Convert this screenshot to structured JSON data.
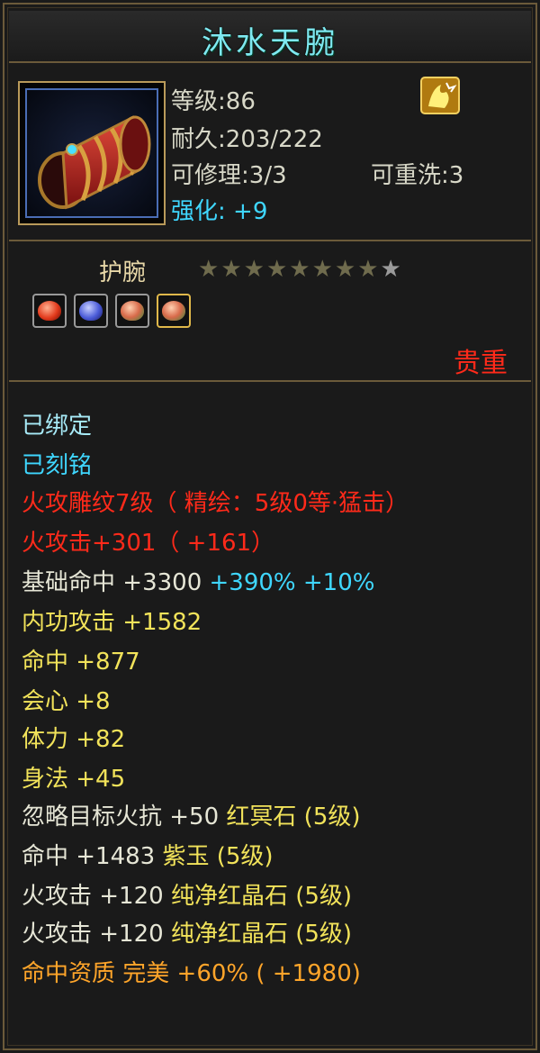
{
  "item": {
    "name": "沐水天腕",
    "level_label": "等级",
    "level_value": "86",
    "durability_label": "耐久",
    "durability_value": "203/222",
    "repairable_label": "可修理",
    "repairable_value": "3/3",
    "rewashable_label": "可重洗",
    "rewashable_value": "3",
    "enhance_label": "强化:",
    "enhance_value": "+9",
    "type": "护腕",
    "stars_total": 9,
    "stars_filled": 8,
    "rarity": "贵重",
    "icon": "bracer-icon",
    "badge_icon": "gold-fire-badge-icon"
  },
  "gems": [
    {
      "icon": "red-gem-icon",
      "color": "#e23a1c"
    },
    {
      "icon": "blue-gem-icon",
      "color": "#4a5bd8"
    },
    {
      "icon": "red-green-gem-icon",
      "color": "#d86a4a"
    },
    {
      "icon": "red-green-gem-icon",
      "color": "#d86a4a"
    }
  ],
  "attributes": {
    "bound": "已绑定",
    "engraved": "已刻铭",
    "carving": "火攻雕纹7级（ 精绘：5级0等·猛击）",
    "fire_attack": "火攻击+301（ +161）",
    "base_hit_label": "基础命中",
    "base_hit_value": "+3300",
    "base_hit_pct1": "+390%",
    "base_hit_pct2": "+10%",
    "inner_attack": "内功攻击  +1582",
    "hit": "命中  +877",
    "crit": "会心  +8",
    "stamina": "体力  +82",
    "agility": "身法  +45",
    "gem1_label": "忽略目标火抗  +50",
    "gem1_name": "红冥石 (5级)",
    "gem2_label": "命中  +1483",
    "gem2_name": "紫玉 (5级)",
    "gem3_label": "火攻击  +120",
    "gem3_name": "纯净红晶石 (5级)",
    "gem4_label": "火攻击  +120",
    "gem4_name": "纯净红晶石 (5级)",
    "quality": "命中资质   完美  +60% ( +1980)"
  }
}
